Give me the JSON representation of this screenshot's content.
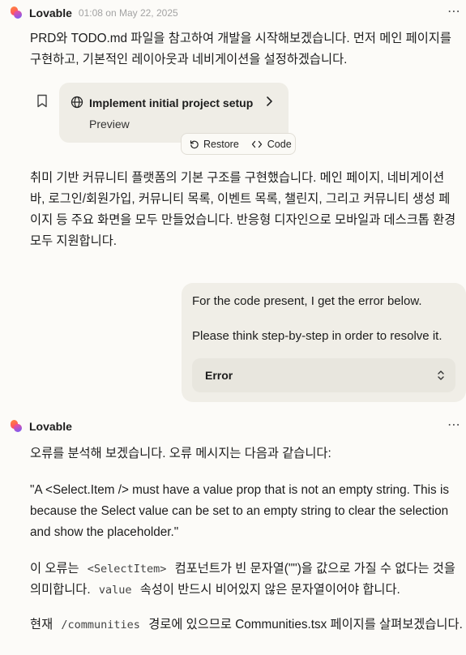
{
  "message1": {
    "author": "Lovable",
    "time": "01:08 on May 22, 2025",
    "more": "⋯",
    "text": "PRD와 TODO.md 파일을 참고하여 개발을 시작해보겠습니다. 먼저 메인 페이지를 구현하고, 기본적인 레이아웃과 네비게이션을 설정하겠습니다.",
    "card": {
      "title": "Implement initial project setup",
      "subtitle": "Preview",
      "restore_label": "Restore",
      "code_label": "Code"
    },
    "text2": "취미 기반 커뮤니티 플랫폼의 기본 구조를 구현했습니다. 메인 페이지, 네비게이션 바, 로그인/회원가입, 커뮤니티 목록, 이벤트 목록, 챌린지, 그리고 커뮤니티 생성 페이지 등 주요 화면을 모두 만들었습니다. 반응형 디자인으로 모바일과 데스크톱 환경 모두 지원합니다."
  },
  "user_message": {
    "line1": "For the code present, I get the error below.",
    "line2": "Please think step-by-step in order to resolve it.",
    "error_label": "Error"
  },
  "message2": {
    "author": "Lovable",
    "more": "⋯",
    "intro": "오류를 분석해 보겠습니다. 오류 메시지는 다음과 같습니다:",
    "quote": "\"A <Select.Item /> must have a value prop that is not an empty string. This is because the Select value can be set to an empty string to clear the selection and show the placeholder.\"",
    "p3_a": "이 오류는 ",
    "p3_code": "<SelectItem>",
    "p3_b": " 컴포넌트가 빈 문자열(\"\")을 값으로 가질 수 없다는 것을 의미합니다. ",
    "p3_code2": "value",
    "p3_c": " 속성이 반드시 비어있지 않은 문자열이어야 합니다.",
    "p4_a": "현재 ",
    "p4_code": "/communities",
    "p4_b": " 경로에 있으므로 Communities.tsx 페이지를 살펴보겠습니다."
  }
}
